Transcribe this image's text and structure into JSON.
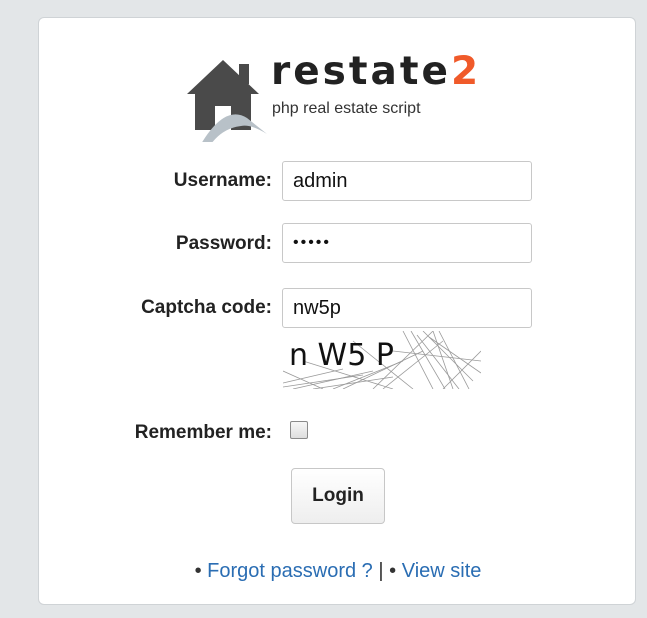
{
  "logo": {
    "title_main": "restate",
    "title_accent": "2",
    "subtitle": "php real estate script",
    "accent_color": "#f05a2a"
  },
  "form": {
    "username_label": "Username:",
    "username_value": "admin",
    "password_label": "Password:",
    "password_value": "•••••",
    "captcha_label": "Captcha code:",
    "captcha_value": "nw5p",
    "captcha_image_text": "n W5 P",
    "remember_label": "Remember me:",
    "remember_checked": false,
    "login_label": "Login"
  },
  "footer": {
    "bullet": "•",
    "forgot_label": "Forgot password ?",
    "separator": "|",
    "view_site_label": "View site",
    "link_color": "#2a6db3"
  }
}
